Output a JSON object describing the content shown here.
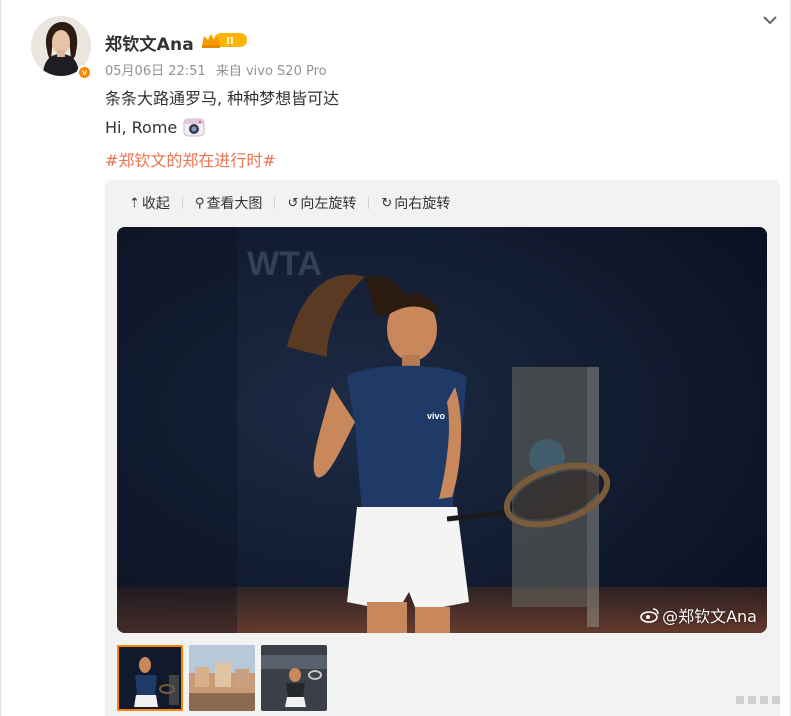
{
  "post": {
    "username": "郑钦文Ana",
    "vip_level": "II",
    "verified_mark": "v",
    "date": "05月06日 22:51",
    "source": "来自 vivo S20 Pro",
    "text_line1": "条条大路通罗马, 种种梦想皆可达",
    "text_line2": "Hi, Rome",
    "hashtag": "#郑钦文的郑在进行时#"
  },
  "toolbar": {
    "collapse": "收起",
    "view_large": "查看大图",
    "rotate_left": "向左旋转",
    "rotate_right": "向右旋转"
  },
  "photo": {
    "watermark": "@郑钦文Ana",
    "shirt_logo": "vivo",
    "banner_text": "WTA"
  },
  "thumbnails": [
    {
      "label": "photo-1",
      "active": true
    },
    {
      "label": "photo-2",
      "active": false
    },
    {
      "label": "photo-3",
      "active": false
    }
  ],
  "colors": {
    "accent": "#ff8200",
    "hashtag": "#eb7350",
    "meta": "#939393"
  },
  "icons": {
    "chevron": "chevron-down-icon",
    "camera": "camera-emoji-icon",
    "weibo": "weibo-logo-icon"
  }
}
